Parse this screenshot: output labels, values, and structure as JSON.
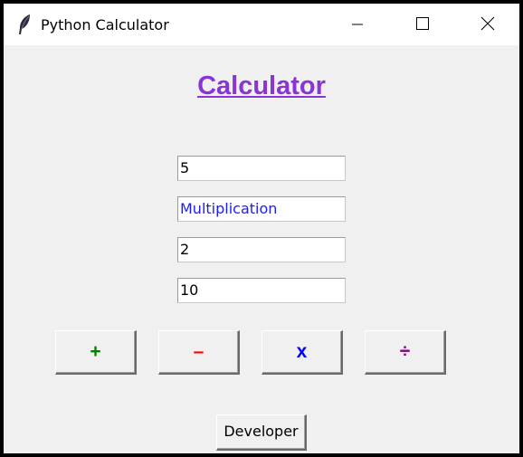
{
  "window": {
    "title": "Python Calculator"
  },
  "heading": "Calculator",
  "fields": {
    "first_number": "5",
    "operation": "Multiplication",
    "second_number": "2",
    "result": "10"
  },
  "buttons": {
    "add": {
      "label": "+",
      "color": "#008000"
    },
    "subtract": {
      "label": "–",
      "color": "#ff0000"
    },
    "multiply": {
      "label": "x",
      "color": "#0000ff"
    },
    "divide": {
      "label": "÷",
      "color": "#800080"
    },
    "developer": "Developer"
  },
  "colors": {
    "heading": "#8a34d6",
    "operation_text": "#1c1cff",
    "background": "#f0f0f0"
  },
  "icons": {
    "app": "feather-icon",
    "minimize": "minimize-icon",
    "maximize": "maximize-icon",
    "close": "close-icon"
  }
}
